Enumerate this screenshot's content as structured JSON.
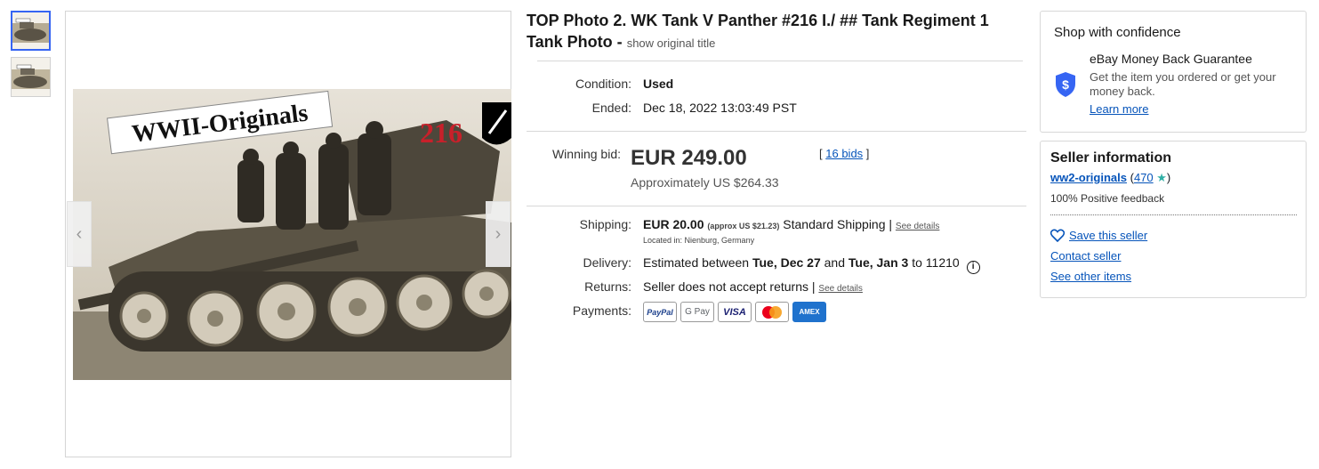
{
  "listing": {
    "title": "TOP Photo 2. WK Tank V Panther #216 I./ ## Tank Regiment 1 Tank Photo -",
    "show_original": "show original title",
    "photo_text": {
      "watermark": "WWII-Originals",
      "number": "216"
    }
  },
  "details": {
    "condition_label": "Condition:",
    "condition_value": "Used",
    "ended_label": "Ended:",
    "ended_value": "Dec 18, 2022 13:03:49 PST"
  },
  "bid": {
    "label": "Winning bid:",
    "price": "EUR 249.00",
    "approx": "Approximately US $264.33",
    "bids_open": "[",
    "bids_count": "16 bids",
    "bids_close": "]"
  },
  "shipping": {
    "label": "Shipping:",
    "price": "EUR 20.00",
    "approx": "(approx US $21.23)",
    "method": "Standard Shipping |",
    "see_details": "See details",
    "location": "Located in: Nienburg, Germany"
  },
  "delivery": {
    "label": "Delivery:",
    "prefix": "Estimated between",
    "start": "Tue, Dec 27",
    "and": "and",
    "end": "Tue, Jan 3",
    "to": "to 11210",
    "info_icon": "i"
  },
  "returns": {
    "label": "Returns:",
    "value": "Seller does not accept returns |",
    "see_details": "See details"
  },
  "payments": {
    "label": "Payments:",
    "badges": [
      "PayPal",
      "G Pay",
      "VISA",
      "",
      "AMEX"
    ]
  },
  "confidence": {
    "title": "Shop with confidence",
    "mbg_title": "eBay Money Back Guarantee",
    "mbg_text": "Get the item you ordered or get your money back.",
    "learn_more": "Learn more",
    "shield_icon": "shield-dollar-icon",
    "shield_color": "#3665f3"
  },
  "seller": {
    "title": "Seller information",
    "name": "ww2-originals",
    "score_open": "(",
    "score": "470",
    "score_close": ")",
    "star": "★",
    "feedback": "100% Positive feedback",
    "save": "Save this seller",
    "contact": "Contact seller",
    "other": "See other items"
  },
  "colors": {
    "link": "#0654ba",
    "accent": "#3665f3",
    "star": "#30b0a6"
  }
}
